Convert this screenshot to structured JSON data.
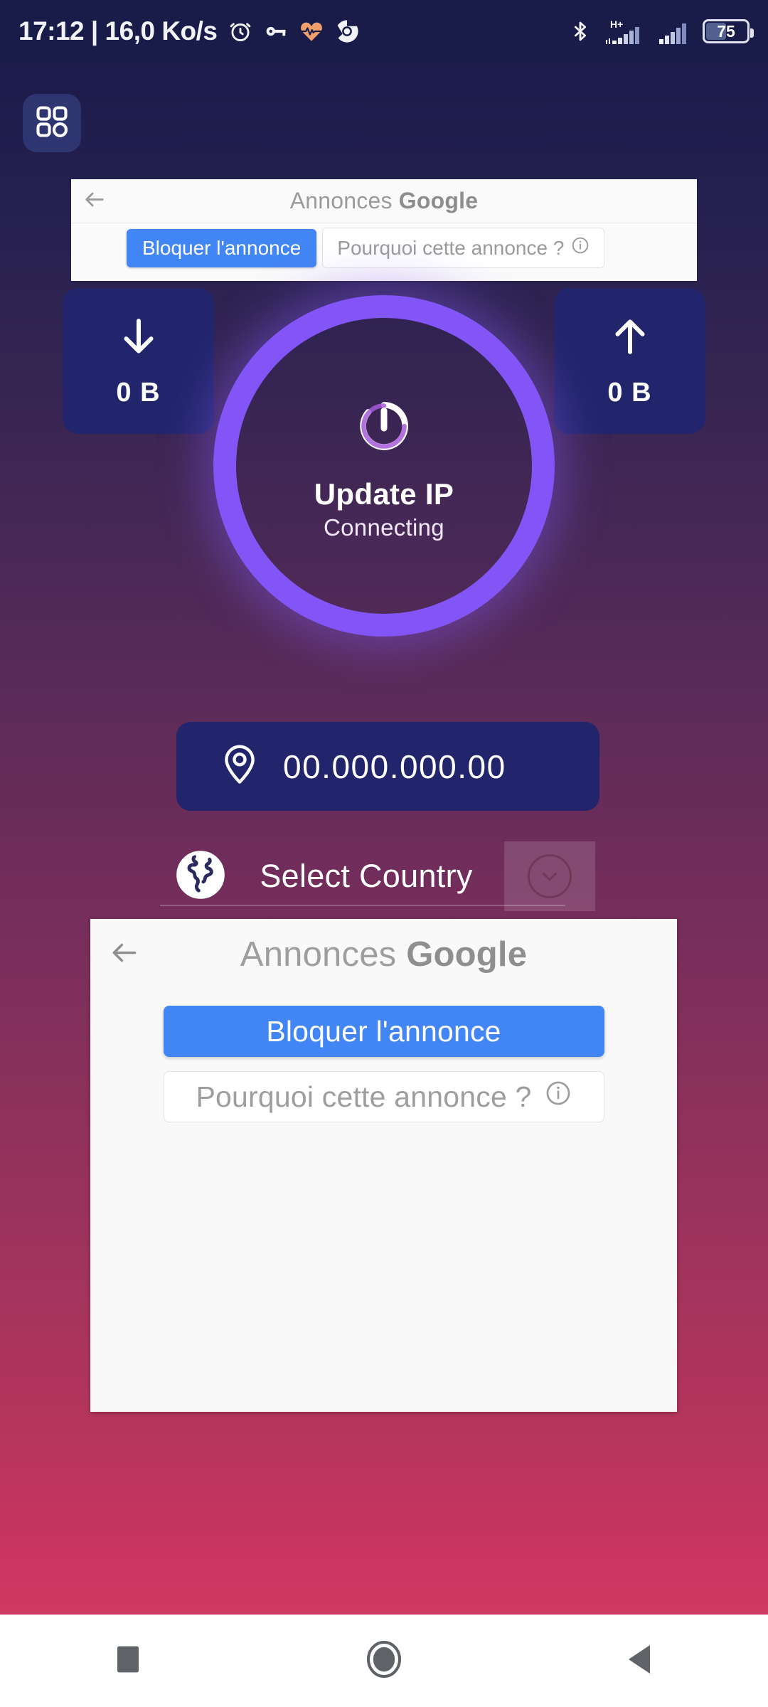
{
  "status_bar": {
    "time": "17:12",
    "separator": "|",
    "network_speed": "16,0 Ko/s",
    "time_and_speed": "17:12 | 16,0 Ko/s",
    "icons": [
      "alarm-clock-icon",
      "vpn-key-icon",
      "heart-pulse-icon",
      "chrome-icon"
    ],
    "bluetooth_icon": "bluetooth-icon",
    "network_type": "H+",
    "signal_icon_1": "signal-bars-icon",
    "signal_icon_2": "signal-bars-icon",
    "battery_level": "75",
    "background_color": "#191c48"
  },
  "launcher": {
    "icon": "app-grid-icon",
    "label": "App grid"
  },
  "ad_top": {
    "back_icon": "back-arrow-icon",
    "title_prefix": "Annonces",
    "title_brand": "Google",
    "block_button": "Bloquer l'annonce",
    "why_button": "Pourquoi cette annonce ?",
    "info_icon": "info-circle-icon",
    "accent_color": "#4285f4"
  },
  "stats": {
    "download": {
      "icon": "arrow-down-icon",
      "value": "0 B"
    },
    "upload": {
      "icon": "arrow-up-icon",
      "value": "0 B"
    },
    "card_color": "#22256b"
  },
  "connect": {
    "power_icon": "power-button-icon",
    "title": "Update IP",
    "status": "Connecting",
    "ring_color": "#8455f6"
  },
  "ip": {
    "location_icon": "location-pin-icon",
    "address": "00.000.000.00",
    "bar_color": "#22256b"
  },
  "country": {
    "globe_icon": "globe-icon",
    "label": "Select Country",
    "chevron_icon": "chevron-down-icon"
  },
  "ad_bottom": {
    "back_icon": "back-arrow-icon",
    "title_prefix": "Annonces",
    "title_brand": "Google",
    "block_button": "Bloquer l'annonce",
    "why_button": "Pourquoi cette annonce ?",
    "info_icon": "info-circle-icon",
    "accent_color": "#4285f4"
  },
  "navbar": {
    "recents": "recents-square-icon",
    "home": "home-circle-icon",
    "back": "back-triangle-icon"
  },
  "theme": {
    "gradient_top": "#191c48",
    "gradient_mid": "#712d5b",
    "gradient_bottom": "#cf3a62",
    "accent_purple": "#8455f6",
    "card_navy": "#22256b"
  }
}
